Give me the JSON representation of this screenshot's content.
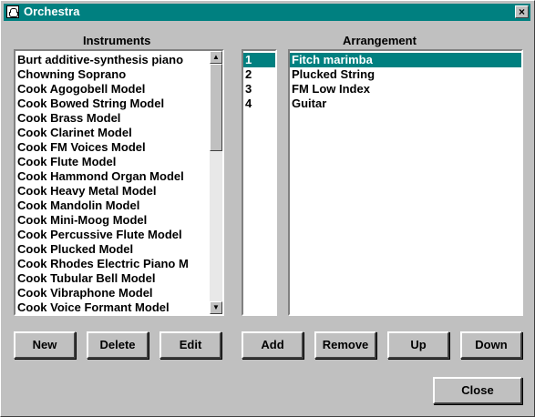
{
  "window": {
    "title": "Orchestra",
    "close_label": "×"
  },
  "instruments": {
    "heading": "Instruments",
    "items": [
      "Burt additive-synthesis piano",
      "Chowning Soprano",
      "Cook Agogobell Model",
      "Cook Bowed String Model",
      "Cook Brass Model",
      "Cook Clarinet Model",
      "Cook FM Voices Model",
      "Cook Flute Model",
      "Cook Hammond Organ Model",
      "Cook Heavy Metal Model",
      "Cook Mandolin Model",
      "Cook Mini-Moog Model",
      "Cook Percussive Flute Model",
      "Cook Plucked Model",
      "Cook Rhodes Electric Piano M",
      "Cook Tubular Bell Model",
      "Cook Vibraphone Model",
      "Cook Voice Formant Model"
    ],
    "scroll_up": "▲",
    "scroll_down": "▼"
  },
  "arrangement": {
    "heading": "Arrangement",
    "numbers": [
      "1",
      "2",
      "3",
      "4"
    ],
    "items": [
      "Fitch marimba",
      "Plucked String",
      "FM Low Index",
      "Guitar"
    ],
    "selected_index": 0
  },
  "buttons": {
    "new": "New",
    "delete": "Delete",
    "edit": "Edit",
    "add": "Add",
    "remove": "Remove",
    "up": "Up",
    "down": "Down",
    "close": "Close"
  },
  "colors": {
    "accent": "#008080",
    "face": "#c0c0c0"
  }
}
